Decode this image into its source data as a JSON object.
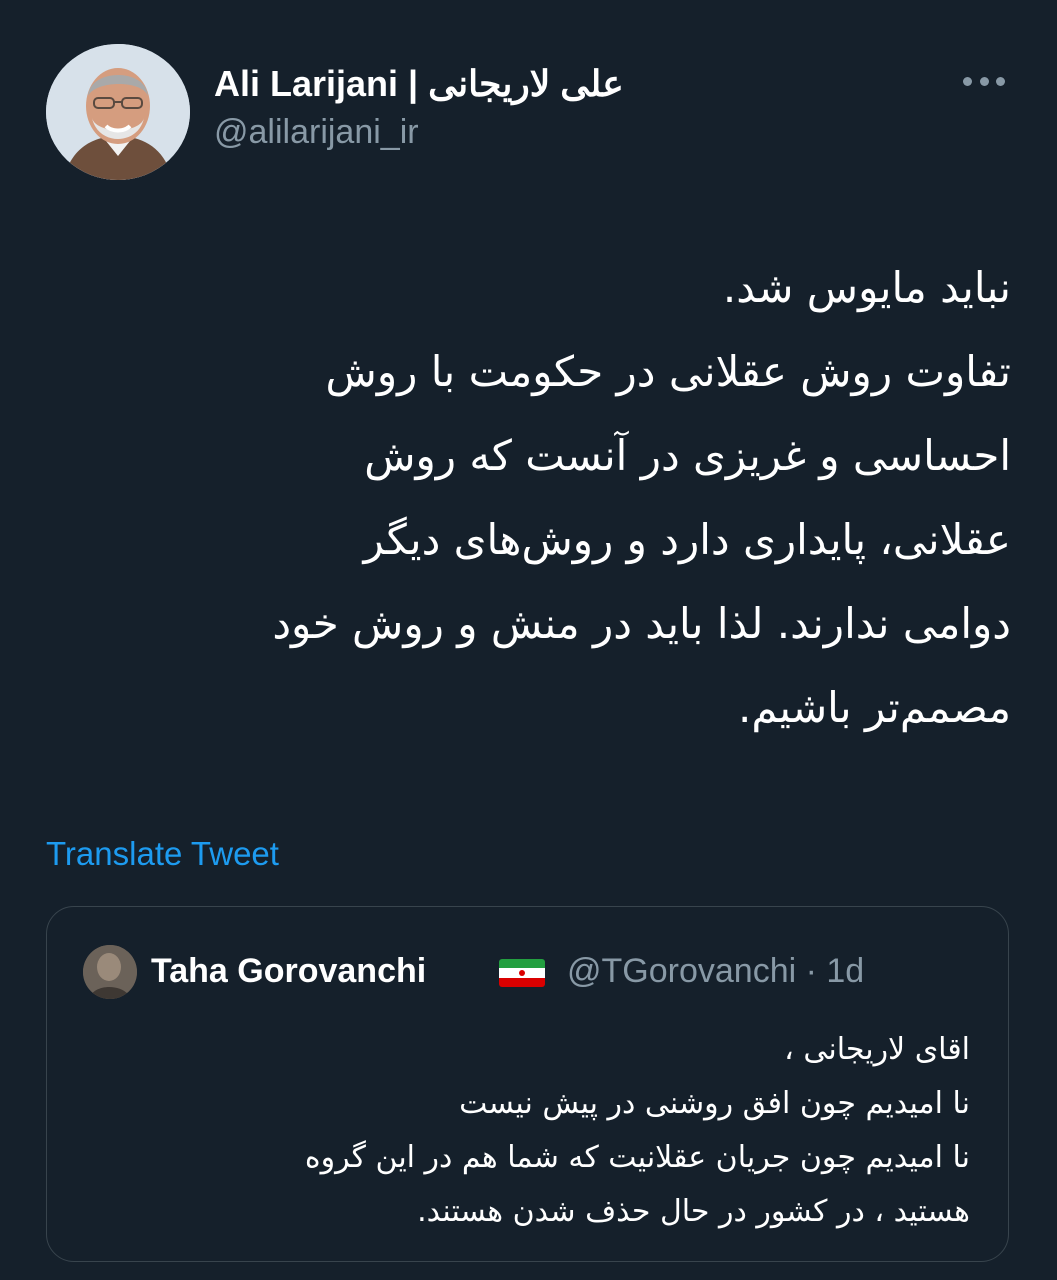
{
  "tweet": {
    "author": {
      "display_name": "Ali Larijani | علی لاریجانی",
      "handle": "@alilarijani_ir",
      "avatar_icon": "profile-photo"
    },
    "more_icon": "more-options-icon",
    "text_lines": [
      "نباید مایوس شد.",
      "تفاوت روش عقلانی در حکومت با روش",
      "احساسی و غریزی در آنست که روش",
      "عقلانی، پایداری دارد و روش‌های دیگر",
      "دوامی ندارند. لذا باید در منش و روش خود",
      "مصمم‌تر باشیم."
    ],
    "translate_label": "Translate Tweet"
  },
  "quoted_tweet": {
    "author_name": "Taha Gorovanchi",
    "flag_icon": "iran-flag-icon",
    "handle": "@TGorovanchi",
    "separator": "·",
    "time": "1d",
    "text_lines": [
      "اقای لاریجانی ،",
      "نا امیدیم چون افق روشنی در پیش نیست",
      "نا امیدیم چون جریان عقلانیت که شما هم در این گروه",
      "هستید ، در کشور در حال حذف شدن هستند."
    ]
  },
  "colors": {
    "background": "#15202b",
    "text_primary": "#ffffff",
    "text_secondary": "#8899a6",
    "link": "#1d9bf0",
    "border": "#38444d"
  }
}
